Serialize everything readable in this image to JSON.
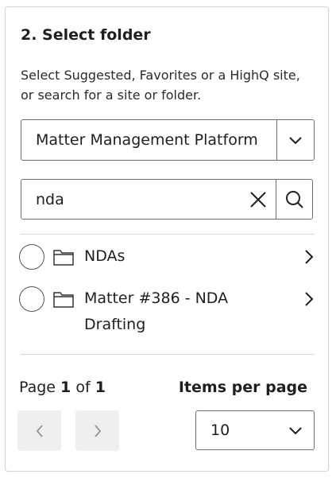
{
  "section": {
    "title": "2. Select folder",
    "description": "Select Suggested, Favorites or a HighQ site, or search for a site or folder."
  },
  "site_select": {
    "value": "Matter Management Platform"
  },
  "search": {
    "value": "nda"
  },
  "results": [
    {
      "label": "NDAs"
    },
    {
      "label": "Matter #386 - NDA Drafting"
    }
  ],
  "pagination": {
    "page_word": "Page",
    "current": "1",
    "of_word": "of",
    "total": "1",
    "items_per_page_label": "Items per page",
    "items_per_page_value": "10"
  },
  "icons": {
    "dropdown": "chevron-down-icon",
    "clear": "close-icon",
    "search": "search-icon",
    "folder": "folder-icon",
    "row_nav": "chevron-right-icon",
    "prev": "chevron-left-icon",
    "next": "chevron-right-icon"
  },
  "colors": {
    "border": "#6f6f6f",
    "divider": "#d9d9d9",
    "text": "#1f1f1f",
    "disabled_button_bg": "#efefef",
    "disabled_icon": "#9a9a9a"
  }
}
